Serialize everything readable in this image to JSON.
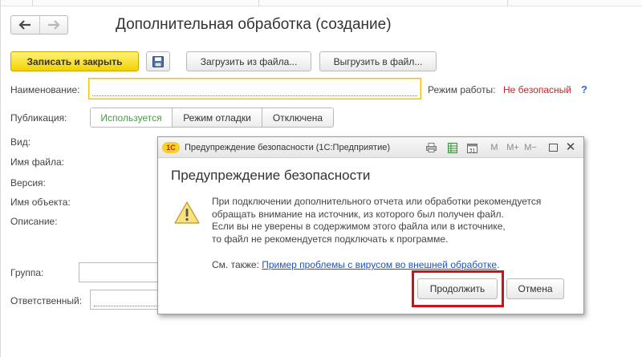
{
  "nav": {
    "back_glyph": "🡐",
    "forward_glyph": "🡒"
  },
  "window": {
    "title": "Дополнительная обработка (создание)"
  },
  "toolbar": {
    "save_close_label": "Записать и закрыть",
    "save_icon": "floppy-disk-icon",
    "load_from_file_label": "Загрузить из файла...",
    "unload_to_file_label": "Выгрузить в файл..."
  },
  "form": {
    "name_label": "Наименование:",
    "name_value": "",
    "mode_label": "Режим работы:",
    "mode_value": "Не безопасный",
    "mode_help": "?",
    "publication_label": "Публикация:",
    "publication_options": [
      "Используется",
      "Режим отладки",
      "Отключена"
    ],
    "publication_selected": "Используется",
    "kind_label": "Вид:",
    "file_name_label": "Имя файла:",
    "version_label": "Версия:",
    "object_name_label": "Имя объекта:",
    "description_label": "Описание:",
    "group_label": "Группа:",
    "responsible_label": "Ответственный:"
  },
  "dialog": {
    "logo_text": "1С",
    "title": "Предупреждение безопасности  (1С:Предприятие)",
    "heading": "Предупреждение безопасности",
    "message_lines": [
      "При подключении дополнительного отчета или обработки рекомендуется",
      "обращать внимание на источник, из которого был получен файл.",
      "Если вы не уверены в содержимом этого файла или в источнике,",
      "то файл не рекомендуется подключать к программе."
    ],
    "see_also_prefix": "См. также: ",
    "see_also_link": "Пример проблемы с вирусом во внешней обработке",
    "see_also_suffix": ".",
    "continue_label": "Продолжить",
    "cancel_label": "Отмена",
    "toolbar_icons": {
      "m": "M",
      "m_plus": "M+",
      "m_minus": "M−",
      "close": "✕"
    }
  },
  "colors": {
    "primary_button": "#f2d200",
    "warning_text": "#c0262d",
    "link": "#1f55b8",
    "highlight_frame": "#d0111a",
    "publication_active": "#4a9a4a"
  }
}
